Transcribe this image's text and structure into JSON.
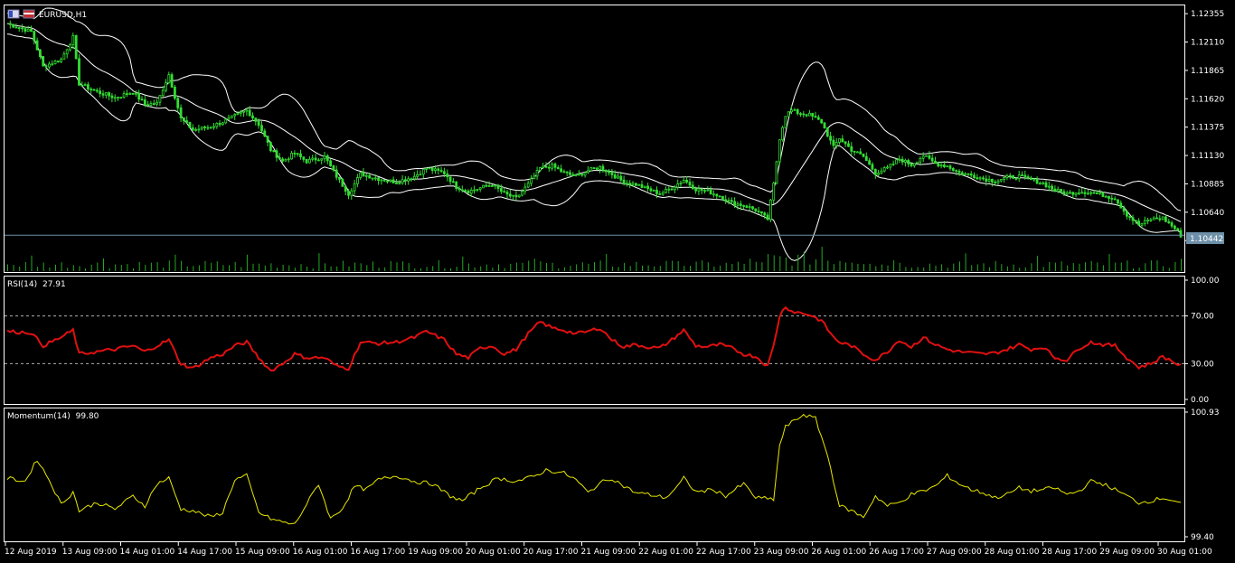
{
  "colors": {
    "background": "#000000",
    "frame": "#ffffff",
    "candle": "#33dd33",
    "volume": "#22aa22",
    "bands": "#ffffff",
    "rsi": "#e01010",
    "momentum": "#e8e800",
    "price_line": "#6d8fa8"
  },
  "symbol_icon": "flag-icon",
  "chart_data": [
    {
      "type": "candlestick",
      "title": "EURUSD,H1",
      "yticks": [
        "1.12355",
        "1.12110",
        "1.11865",
        "1.11620",
        "1.11375",
        "1.11130",
        "1.10885",
        "1.10640",
        "1.10395"
      ],
      "ylim": [
        1.1035,
        1.12395
      ],
      "current_price": "1.10442",
      "overlays": [
        "Bollinger Bands",
        "Volume"
      ],
      "xticks": [
        "12 Aug 2019",
        "13 Aug 09:00",
        "14 Aug 01:00",
        "14 Aug 17:00",
        "15 Aug 09:00",
        "16 Aug 01:00",
        "16 Aug 17:00",
        "19 Aug 09:00",
        "20 Aug 01:00",
        "20 Aug 17:00",
        "21 Aug 09:00",
        "22 Aug 01:00",
        "22 Aug 17:00",
        "23 Aug 09:00",
        "26 Aug 01:00",
        "26 Aug 17:00",
        "27 Aug 09:00",
        "28 Aug 01:00",
        "28 Aug 17:00",
        "29 Aug 09:00",
        "30 Aug 01:00"
      ],
      "close_keypoints": [
        [
          0,
          1.1227
        ],
        [
          8,
          1.122
        ],
        [
          12,
          1.119
        ],
        [
          18,
          1.1196
        ],
        [
          22,
          1.1215
        ],
        [
          24,
          1.1175
        ],
        [
          30,
          1.1168
        ],
        [
          36,
          1.1163
        ],
        [
          42,
          1.1168
        ],
        [
          46,
          1.1157
        ],
        [
          50,
          1.1158
        ],
        [
          54,
          1.1183
        ],
        [
          58,
          1.1145
        ],
        [
          62,
          1.1135
        ],
        [
          68,
          1.1138
        ],
        [
          72,
          1.1142
        ],
        [
          76,
          1.1147
        ],
        [
          80,
          1.1152
        ],
        [
          84,
          1.114
        ],
        [
          88,
          1.1118
        ],
        [
          92,
          1.1108
        ],
        [
          96,
          1.1115
        ],
        [
          100,
          1.1108
        ],
        [
          106,
          1.1112
        ],
        [
          110,
          1.1095
        ],
        [
          114,
          1.108
        ],
        [
          118,
          1.1097
        ],
        [
          124,
          1.1093
        ],
        [
          130,
          1.109
        ],
        [
          136,
          1.1095
        ],
        [
          140,
          1.1102
        ],
        [
          146,
          1.1098
        ],
        [
          150,
          1.1086
        ],
        [
          154,
          1.1082
        ],
        [
          158,
          1.1085
        ],
        [
          162,
          1.1088
        ],
        [
          166,
          1.108
        ],
        [
          170,
          1.1076
        ],
        [
          174,
          1.1088
        ],
        [
          178,
          1.1102
        ],
        [
          182,
          1.1104
        ],
        [
          186,
          1.1098
        ],
        [
          190,
          1.1095
        ],
        [
          194,
          1.11
        ],
        [
          198,
          1.1103
        ],
        [
          202,
          1.1097
        ],
        [
          206,
          1.109
        ],
        [
          210,
          1.1088
        ],
        [
          214,
          1.1084
        ],
        [
          218,
          1.108
        ],
        [
          222,
          1.1085
        ],
        [
          226,
          1.1092
        ],
        [
          230,
          1.1084
        ],
        [
          234,
          1.1082
        ],
        [
          238,
          1.1078
        ],
        [
          242,
          1.1072
        ],
        [
          246,
          1.107
        ],
        [
          250,
          1.1066
        ],
        [
          254,
          1.1058
        ],
        [
          256,
          1.1088
        ],
        [
          258,
          1.1128
        ],
        [
          260,
          1.1148
        ],
        [
          262,
          1.1152
        ],
        [
          264,
          1.115
        ],
        [
          268,
          1.1148
        ],
        [
          272,
          1.1142
        ],
        [
          276,
          1.112
        ],
        [
          278,
          1.1128
        ],
        [
          282,
          1.1118
        ],
        [
          286,
          1.1112
        ],
        [
          290,
          1.1098
        ],
        [
          294,
          1.1102
        ],
        [
          298,
          1.111
        ],
        [
          302,
          1.1105
        ],
        [
          306,
          1.1113
        ],
        [
          310,
          1.1106
        ],
        [
          314,
          1.1104
        ],
        [
          318,
          1.1098
        ],
        [
          322,
          1.1096
        ],
        [
          326,
          1.1093
        ],
        [
          330,
          1.1091
        ],
        [
          334,
          1.1094
        ],
        [
          338,
          1.1095
        ],
        [
          342,
          1.1092
        ],
        [
          346,
          1.1089
        ],
        [
          350,
          1.1083
        ],
        [
          354,
          1.108
        ],
        [
          358,
          1.1082
        ],
        [
          362,
          1.1081
        ],
        [
          366,
          1.1079
        ],
        [
          370,
          1.1076
        ],
        [
          374,
          1.1062
        ],
        [
          378,
          1.1053
        ],
        [
          382,
          1.1058
        ],
        [
          386,
          1.1059
        ],
        [
          390,
          1.105
        ],
        [
          392,
          1.1044
        ]
      ]
    },
    {
      "type": "line",
      "name": "RSI(14)",
      "value_label": "27.91",
      "yticks": [
        "100.00",
        "70.00",
        "30.00",
        "0.00"
      ],
      "ylim": [
        0,
        100
      ],
      "levels": [
        70,
        30
      ],
      "values_keypoints": [
        [
          0,
          57
        ],
        [
          8,
          56
        ],
        [
          12,
          45
        ],
        [
          18,
          52
        ],
        [
          22,
          58
        ],
        [
          24,
          38
        ],
        [
          30,
          40
        ],
        [
          36,
          42
        ],
        [
          42,
          45
        ],
        [
          46,
          40
        ],
        [
          50,
          45
        ],
        [
          54,
          50
        ],
        [
          58,
          30
        ],
        [
          62,
          26
        ],
        [
          68,
          35
        ],
        [
          72,
          38
        ],
        [
          76,
          45
        ],
        [
          80,
          48
        ],
        [
          84,
          35
        ],
        [
          88,
          24
        ],
        [
          92,
          30
        ],
        [
          96,
          38
        ],
        [
          100,
          35
        ],
        [
          106,
          35
        ],
        [
          110,
          28
        ],
        [
          114,
          26
        ],
        [
          118,
          48
        ],
        [
          124,
          47
        ],
        [
          130,
          48
        ],
        [
          136,
          52
        ],
        [
          140,
          57
        ],
        [
          146,
          50
        ],
        [
          150,
          38
        ],
        [
          154,
          35
        ],
        [
          158,
          43
        ],
        [
          162,
          45
        ],
        [
          166,
          38
        ],
        [
          170,
          42
        ],
        [
          174,
          55
        ],
        [
          178,
          65
        ],
        [
          182,
          60
        ],
        [
          186,
          58
        ],
        [
          190,
          55
        ],
        [
          194,
          57
        ],
        [
          198,
          60
        ],
        [
          202,
          50
        ],
        [
          206,
          44
        ],
        [
          210,
          46
        ],
        [
          214,
          44
        ],
        [
          218,
          43
        ],
        [
          222,
          50
        ],
        [
          226,
          58
        ],
        [
          230,
          45
        ],
        [
          234,
          44
        ],
        [
          238,
          46
        ],
        [
          242,
          43
        ],
        [
          246,
          38
        ],
        [
          250,
          36
        ],
        [
          254,
          28
        ],
        [
          256,
          45
        ],
        [
          258,
          70
        ],
        [
          260,
          78
        ],
        [
          262,
          74
        ],
        [
          264,
          73
        ],
        [
          268,
          71
        ],
        [
          272,
          66
        ],
        [
          276,
          52
        ],
        [
          278,
          48
        ],
        [
          282,
          45
        ],
        [
          286,
          38
        ],
        [
          290,
          33
        ],
        [
          294,
          40
        ],
        [
          298,
          50
        ],
        [
          302,
          44
        ],
        [
          306,
          52
        ],
        [
          310,
          46
        ],
        [
          314,
          42
        ],
        [
          318,
          40
        ],
        [
          322,
          39
        ],
        [
          326,
          38
        ],
        [
          330,
          39
        ],
        [
          334,
          42
        ],
        [
          338,
          46
        ],
        [
          342,
          42
        ],
        [
          346,
          44
        ],
        [
          350,
          35
        ],
        [
          354,
          33
        ],
        [
          358,
          43
        ],
        [
          362,
          48
        ],
        [
          366,
          46
        ],
        [
          370,
          45
        ],
        [
          374,
          35
        ],
        [
          378,
          27
        ],
        [
          382,
          30
        ],
        [
          386,
          36
        ],
        [
          390,
          31
        ],
        [
          392,
          28
        ]
      ]
    },
    {
      "type": "line",
      "name": "Momentum(14)",
      "value_label": "99.80",
      "yticks": [
        "100.93",
        "99.40"
      ],
      "ylim": [
        99.4,
        100.93
      ],
      "values_keypoints": [
        [
          0,
          100.12
        ],
        [
          6,
          100.08
        ],
        [
          10,
          100.35
        ],
        [
          14,
          100.1
        ],
        [
          18,
          99.8
        ],
        [
          22,
          99.95
        ],
        [
          24,
          99.72
        ],
        [
          30,
          99.82
        ],
        [
          36,
          99.74
        ],
        [
          42,
          99.9
        ],
        [
          46,
          99.78
        ],
        [
          50,
          100.05
        ],
        [
          54,
          100.12
        ],
        [
          58,
          99.74
        ],
        [
          62,
          99.72
        ],
        [
          68,
          99.64
        ],
        [
          72,
          99.7
        ],
        [
          76,
          100.1
        ],
        [
          80,
          100.15
        ],
        [
          84,
          99.7
        ],
        [
          88,
          99.62
        ],
        [
          92,
          99.58
        ],
        [
          96,
          99.55
        ],
        [
          100,
          99.8
        ],
        [
          104,
          100.05
        ],
        [
          108,
          99.62
        ],
        [
          112,
          99.75
        ],
        [
          116,
          100.02
        ],
        [
          120,
          99.98
        ],
        [
          124,
          100.1
        ],
        [
          130,
          100.15
        ],
        [
          136,
          100.08
        ],
        [
          142,
          100.05
        ],
        [
          148,
          99.9
        ],
        [
          152,
          99.84
        ],
        [
          158,
          100.0
        ],
        [
          164,
          100.12
        ],
        [
          170,
          100.08
        ],
        [
          176,
          100.14
        ],
        [
          180,
          100.22
        ],
        [
          186,
          100.18
        ],
        [
          190,
          100.1
        ],
        [
          194,
          99.94
        ],
        [
          198,
          100.06
        ],
        [
          202,
          100.12
        ],
        [
          206,
          100.02
        ],
        [
          210,
          99.94
        ],
        [
          214,
          99.92
        ],
        [
          220,
          99.88
        ],
        [
          224,
          100.02
        ],
        [
          226,
          100.12
        ],
        [
          230,
          99.95
        ],
        [
          236,
          99.98
        ],
        [
          240,
          99.9
        ],
        [
          246,
          100.05
        ],
        [
          250,
          99.88
        ],
        [
          256,
          99.86
        ],
        [
          258,
          100.52
        ],
        [
          260,
          100.75
        ],
        [
          262,
          100.8
        ],
        [
          266,
          100.9
        ],
        [
          270,
          100.85
        ],
        [
          274,
          100.4
        ],
        [
          278,
          99.78
        ],
        [
          282,
          99.72
        ],
        [
          286,
          99.64
        ],
        [
          290,
          99.9
        ],
        [
          294,
          99.78
        ],
        [
          298,
          99.82
        ],
        [
          302,
          99.92
        ],
        [
          306,
          99.96
        ],
        [
          310,
          100.02
        ],
        [
          314,
          100.15
        ],
        [
          318,
          100.05
        ],
        [
          322,
          99.98
        ],
        [
          326,
          99.94
        ],
        [
          330,
          99.88
        ],
        [
          334,
          99.92
        ],
        [
          338,
          100.0
        ],
        [
          342,
          99.96
        ],
        [
          346,
          99.98
        ],
        [
          350,
          100.0
        ],
        [
          354,
          99.92
        ],
        [
          358,
          99.96
        ],
        [
          362,
          100.08
        ],
        [
          366,
          100.05
        ],
        [
          370,
          99.98
        ],
        [
          374,
          99.9
        ],
        [
          378,
          99.82
        ],
        [
          382,
          99.84
        ],
        [
          386,
          99.88
        ],
        [
          390,
          99.84
        ],
        [
          392,
          99.8
        ]
      ]
    }
  ]
}
